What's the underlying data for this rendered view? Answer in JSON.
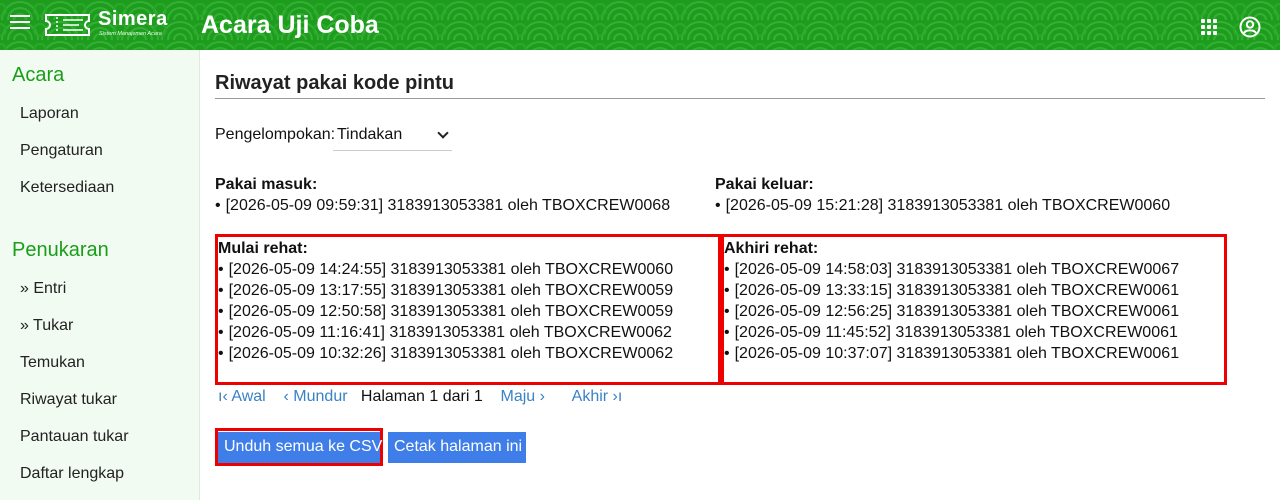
{
  "header": {
    "logo_name": "Simera",
    "logo_tagline": "Sistem Manajemen Acara",
    "app_title": "Acara Uji Coba",
    "brand_color": "#1e9c1e"
  },
  "sidebar": {
    "sections": [
      {
        "heading": "Acara",
        "items": [
          "Laporan",
          "Pengaturan",
          "Ketersediaan"
        ]
      },
      {
        "heading": "Penukaran",
        "items": [
          "» Entri",
          "» Tukar",
          "Temukan",
          "Riwayat tukar",
          "Pantauan tukar",
          "Daftar lengkap"
        ]
      }
    ]
  },
  "main": {
    "title": "Riwayat pakai kode pintu",
    "grouping_label": "Pengelompokan:",
    "grouping_value": "Tindakan",
    "entry_in": {
      "label": "Pakai masuk:",
      "entries": [
        "[2026-05-09 09:59:31] 3183913053381 oleh TBOXCREW0068"
      ]
    },
    "entry_out": {
      "label": "Pakai keluar:",
      "entries": [
        "[2026-05-09 15:21:28] 3183913053381 oleh TBOXCREW0060"
      ]
    },
    "break_start": {
      "label": "Mulai rehat:",
      "entries": [
        "[2026-05-09 14:24:55] 3183913053381 oleh TBOXCREW0060",
        "[2026-05-09 13:17:55] 3183913053381 oleh TBOXCREW0059",
        "[2026-05-09 12:50:58] 3183913053381 oleh TBOXCREW0059",
        "[2026-05-09 11:16:41] 3183913053381 oleh TBOXCREW0062",
        "[2026-05-09 10:32:26] 3183913053381 oleh TBOXCREW0062"
      ]
    },
    "break_end": {
      "label": "Akhiri rehat:",
      "entries": [
        "[2026-05-09 14:58:03] 3183913053381 oleh TBOXCREW0067",
        "[2026-05-09 13:33:15] 3183913053381 oleh TBOXCREW0061",
        "[2026-05-09 12:56:25] 3183913053381 oleh TBOXCREW0061",
        "[2026-05-09 11:45:52] 3183913053381 oleh TBOXCREW0061",
        "[2026-05-09 10:37:07] 3183913053381 oleh TBOXCREW0061"
      ]
    },
    "pager": {
      "first": "ı‹ Awal",
      "prev": "‹ Mundur",
      "status": "Halaman 1 dari 1",
      "next": "Maju ›",
      "last": "Akhir ›ı"
    },
    "buttons": {
      "download_csv": "Unduh semua ke CSV",
      "print_page": "Cetak halaman ini"
    }
  }
}
